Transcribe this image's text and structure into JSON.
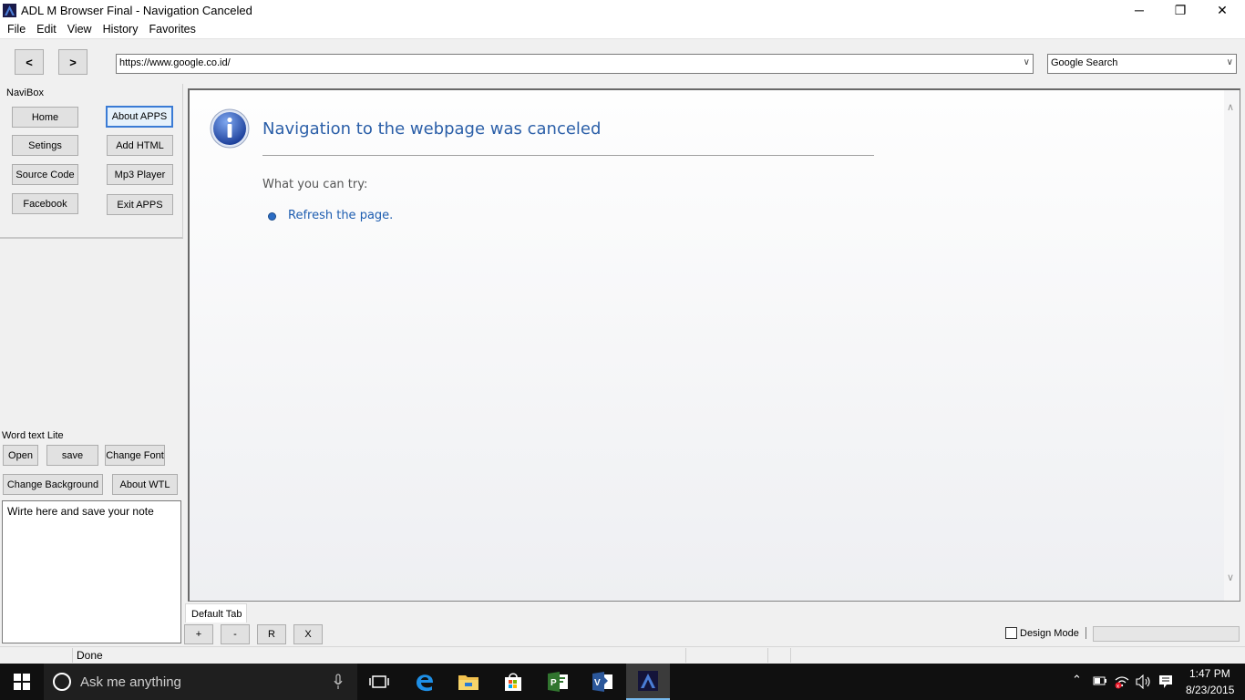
{
  "window": {
    "title": "ADL M Browser Final - Navigation Canceled",
    "minimize": "─",
    "restore": "❐",
    "close": "✕"
  },
  "menu": [
    "File",
    "Edit",
    "View",
    "History",
    "Favorites"
  ],
  "toolbar": {
    "back": "<",
    "forward": ">",
    "url": "https://www.google.co.id/",
    "search_engine": "Google Search"
  },
  "navibox": {
    "label": "NaviBox",
    "buttons": [
      "Home",
      "About APPS",
      "Setings",
      "Add HTML",
      "Source Code",
      "Mp3 Player",
      "Facebook",
      "Exit APPS"
    ]
  },
  "word_text_lite": {
    "label": "Word text Lite",
    "buttons": [
      "Open",
      "save",
      "Change Font",
      "Change Background",
      "About WTL"
    ],
    "note_text": "Wirte here and save your note"
  },
  "page": {
    "heading": "Navigation to the webpage was canceled",
    "try_label": "What you can try:",
    "refresh_link": "Refresh the page."
  },
  "tabs": {
    "default_tab": "Default Tab",
    "buttons": [
      "+",
      "-",
      "R",
      "X"
    ],
    "design_mode": "Design Mode"
  },
  "status": {
    "text": "Done"
  },
  "taskbar": {
    "search_placeholder": "Ask me anything",
    "time": "1:47 PM",
    "date": "8/23/2015",
    "icons": [
      "task-view-icon",
      "edge-icon",
      "file-explorer-icon",
      "store-icon",
      "project-icon",
      "visio-icon",
      "adl-browser-icon"
    ]
  },
  "colors": {
    "heading_blue": "#2b5fa8",
    "link_blue": "#1e5db0",
    "taskbar_bg": "#101010"
  }
}
